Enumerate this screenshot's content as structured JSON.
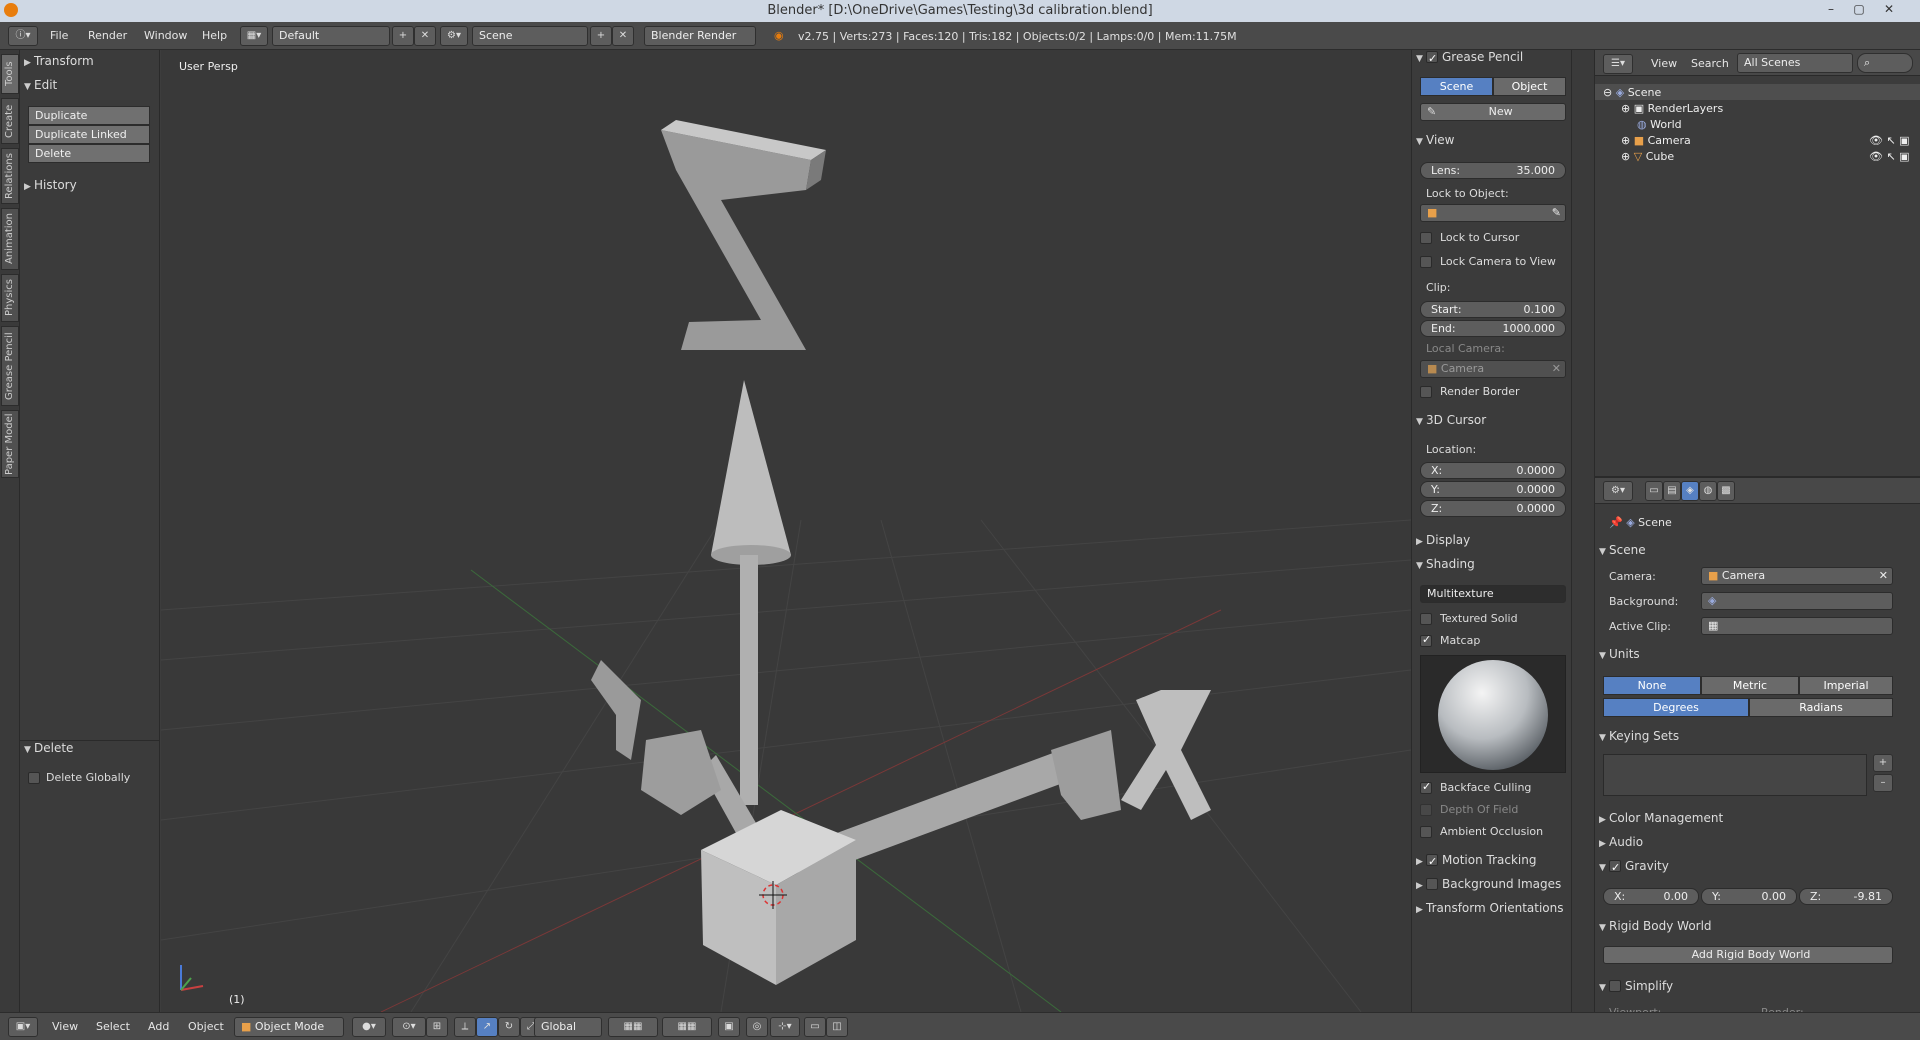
{
  "window": {
    "title": "Blender* [D:\\OneDrive\\Games\\Testing\\3d calibration.blend]"
  },
  "header": {
    "menu": [
      "File",
      "Render",
      "Window",
      "Help"
    ],
    "layout": "Default",
    "scene": "Scene",
    "engine": "Blender Render",
    "stats": "v2.75 | Verts:273 | Faces:120 | Tris:182 | Objects:0/2 | Lamps:0/0 | Mem:11.75M"
  },
  "left_tabs": [
    "Tools",
    "Create",
    "Relations",
    "Animation",
    "Physics",
    "Grease Pencil",
    "Paper Model"
  ],
  "toolshelf": {
    "transform": "Transform",
    "edit": "Edit",
    "buttons": [
      "Duplicate",
      "Duplicate Linked",
      "Delete"
    ],
    "history": "History",
    "operator": "Delete",
    "delete_globally": "Delete Globally"
  },
  "viewport": {
    "label": "User Persp",
    "frame": "(1)"
  },
  "npanel": {
    "grease_pencil": "Grease Pencil",
    "gp_scene": "Scene",
    "gp_object": "Object",
    "gp_new": "New",
    "view": "View",
    "lens_label": "Lens:",
    "lens_value": "35.000",
    "lock_to_object": "Lock to Object:",
    "lock_to_cursor": "Lock to Cursor",
    "lock_camera": "Lock Camera to View",
    "clip": "Clip:",
    "start_label": "Start:",
    "start_value": "0.100",
    "end_label": "End:",
    "end_value": "1000.000",
    "local_camera": "Local Camera:",
    "camera": "Camera",
    "render_border": "Render Border",
    "cursor": "3D Cursor",
    "location": "Location:",
    "x_label": "X:",
    "y_label": "Y:",
    "z_label": "Z:",
    "x_value": "0.0000",
    "y_value": "0.0000",
    "z_value": "0.0000",
    "display": "Display",
    "shading": "Shading",
    "shading_mode": "Multitexture",
    "textured_solid": "Textured Solid",
    "matcap": "Matcap",
    "backface": "Backface Culling",
    "dof": "Depth Of Field",
    "ao": "Ambient Occlusion",
    "motion_tracking": "Motion Tracking",
    "background_images": "Background Images",
    "transform_orientations": "Transform Orientations"
  },
  "outliner": {
    "view": "View",
    "search": "Search",
    "filter": "All Scenes",
    "items": [
      "Scene",
      "RenderLayers",
      "World",
      "Camera",
      "Cube"
    ]
  },
  "properties": {
    "context": "Scene",
    "scene_panel": "Scene",
    "camera_label": "Camera:",
    "camera_value": "Camera",
    "background_label": "Background:",
    "active_clip_label": "Active Clip:",
    "units": "Units",
    "unit_none": "None",
    "unit_metric": "Metric",
    "unit_imperial": "Imperial",
    "degrees": "Degrees",
    "radians": "Radians",
    "keying_sets": "Keying Sets",
    "color_management": "Color Management",
    "audio": "Audio",
    "gravity": "Gravity",
    "gx_label": "X:",
    "gx_value": "0.00",
    "gy_label": "Y:",
    "gy_value": "0.00",
    "gz_label": "Z:",
    "gz_value": "-9.81",
    "rigid_body_world": "Rigid Body World",
    "add_rigid_body": "Add Rigid Body World",
    "simplify": "Simplify",
    "viewport_label": "Viewport:",
    "render_label": "Render:"
  },
  "footer": {
    "menu": [
      "View",
      "Select",
      "Add",
      "Object"
    ],
    "mode": "Object Mode",
    "orientation": "Global"
  },
  "colors": {
    "accent": "#5680c2",
    "logo": "#e87d0d",
    "viewport_bg": "#393939"
  }
}
